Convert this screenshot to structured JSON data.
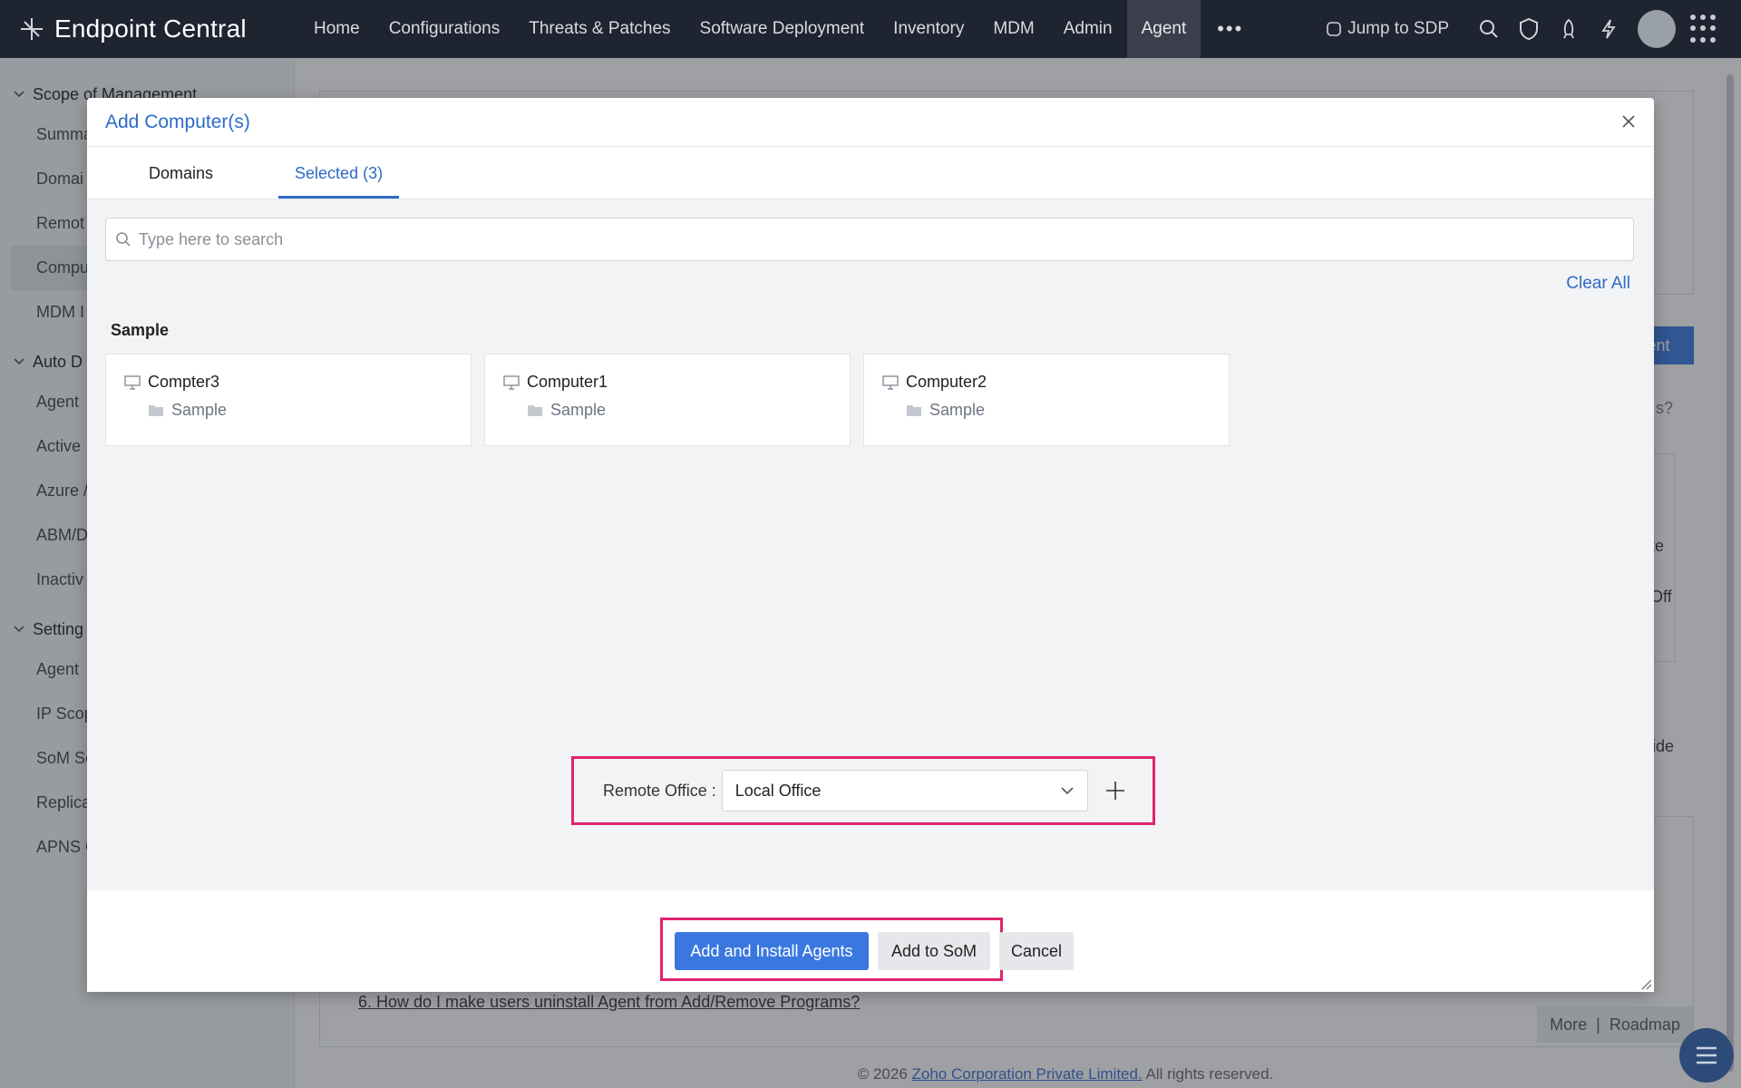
{
  "app": {
    "brand": "Endpoint Central"
  },
  "nav": {
    "items": [
      "Home",
      "Configurations",
      "Threats & Patches",
      "Software Deployment",
      "Inventory",
      "MDM",
      "Admin",
      "Agent"
    ],
    "active": "Agent",
    "more": "•••",
    "jump_label": "Jump to SDP"
  },
  "sidebar": {
    "groups": [
      {
        "label": "Scope of Management",
        "items": [
          "Summa",
          "Domai",
          "Remot",
          "Compu",
          "MDM I"
        ]
      },
      {
        "label": "Auto D",
        "items": [
          "Agent",
          "Active",
          "Azure /",
          "ABM/D",
          "Inactiv"
        ]
      },
      {
        "label": "Setting",
        "items": [
          "Agent",
          "IP Scop",
          "SoM Se",
          "Replica",
          "APNS C"
        ]
      }
    ],
    "active_item": "Compu"
  },
  "background": {
    "faq_text": "6. How do I make users uninstall Agent from Add/Remove Programs?",
    "more": "More",
    "separator": "|",
    "roadmap": "Roadmap",
    "right_fragments": [
      "gent",
      "s?",
      "te",
      "Off",
      "ide"
    ],
    "footer_prefix": "© 2026",
    "footer_link": "Zoho Corporation Private Limited.",
    "footer_suffix": "All rights reserved."
  },
  "modal": {
    "title": "Add Computer(s)",
    "tabs": [
      {
        "label": "Domains",
        "active": false
      },
      {
        "label": "Selected (3)",
        "active": true
      }
    ],
    "search_placeholder": "Type here to search",
    "clear_all": "Clear All",
    "group_label": "Sample",
    "computers": [
      {
        "name": "Compter3",
        "domain": "Sample"
      },
      {
        "name": "Computer1",
        "domain": "Sample"
      },
      {
        "name": "Computer2",
        "domain": "Sample"
      }
    ],
    "remote_office_label": "Remote Office :",
    "remote_office_value": "Local Office",
    "buttons": {
      "primary": "Add and Install Agents",
      "secondary": "Add to SoM",
      "cancel": "Cancel"
    }
  },
  "colors": {
    "accent": "#2e6bc6",
    "primary_button": "#3a78e0",
    "highlight_box": "#e0226e",
    "topbar": "#1f2431"
  }
}
